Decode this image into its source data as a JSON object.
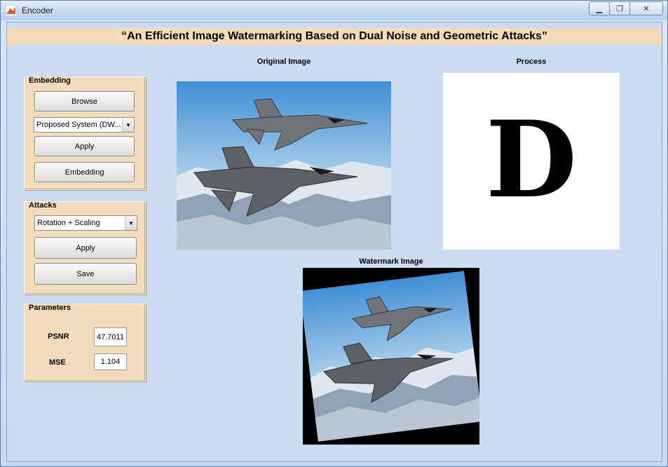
{
  "window": {
    "title": "Encoder",
    "controls": [
      "minimize-icon",
      "restore-icon",
      "close-icon"
    ]
  },
  "banner": {
    "text": "“An Efficient Image Watermarking Based on Dual Noise and Geometric Attacks”"
  },
  "embedding": {
    "title": "Embedding",
    "browse_label": "Browse",
    "method_selected": "Proposed System (DW...",
    "apply_label": "Apply",
    "embed_label": "Embedding"
  },
  "attacks": {
    "title": "Attacks",
    "attack_selected": "Rotation + Scaling",
    "apply_label": "Apply",
    "save_label": "Save"
  },
  "parameters": {
    "title": "Parameters",
    "psnr_label": "PSNR",
    "psnr_value": "47.7011",
    "mse_label": "MSE",
    "mse_value": "1.104"
  },
  "axes": {
    "original_title": "Original Image",
    "process_title": "Process",
    "process_letter": "D",
    "watermark_title": "Watermark Image"
  },
  "colors": {
    "background": "#ccdcf3",
    "panel": "#f3dcbb",
    "banner": "#f5dcb7"
  }
}
